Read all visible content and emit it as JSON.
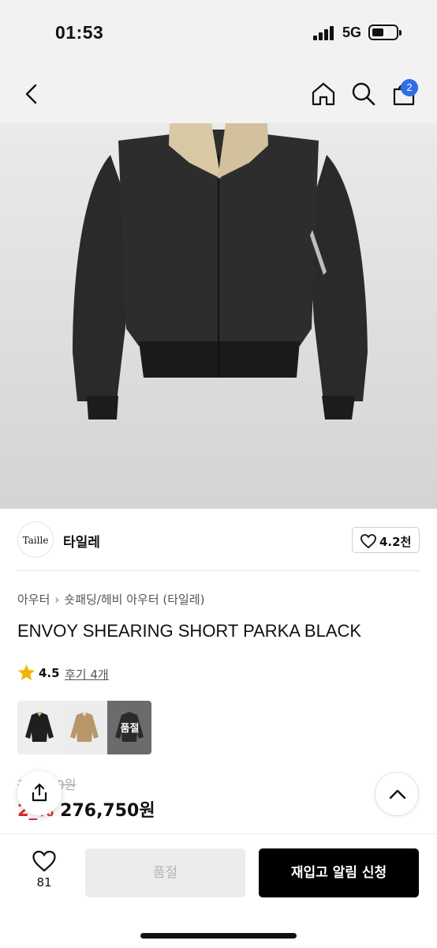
{
  "status_bar": {
    "time": "01:53",
    "network": "5G"
  },
  "nav": {
    "cart_count": "2"
  },
  "brand": {
    "logo_text": "Taille",
    "name": "타일레",
    "like_count": "4.2천"
  },
  "breadcrumb": {
    "category": "아우터",
    "subcategory": "숏패딩/헤비 아우터 (타일레)"
  },
  "product": {
    "title": "ENVOY SHEARING SHORT PARKA BLACK",
    "rating": "4.5",
    "review_link": "후기 4개",
    "original_price": "3__,_90원",
    "discount": "2_%",
    "sale_price": "276,750원",
    "color_options": [
      {
        "color": "black",
        "state": ""
      },
      {
        "color": "beige",
        "state": ""
      },
      {
        "color": "black-alt",
        "state": "품절"
      }
    ]
  },
  "bottom_bar": {
    "wish_count": "81",
    "soldout_label": "품절",
    "restock_label": "재입고 알림 신청"
  },
  "colors": {
    "accent_badge": "#2f6ee8",
    "discount": "#e0262d",
    "primary_button": "#000000"
  }
}
